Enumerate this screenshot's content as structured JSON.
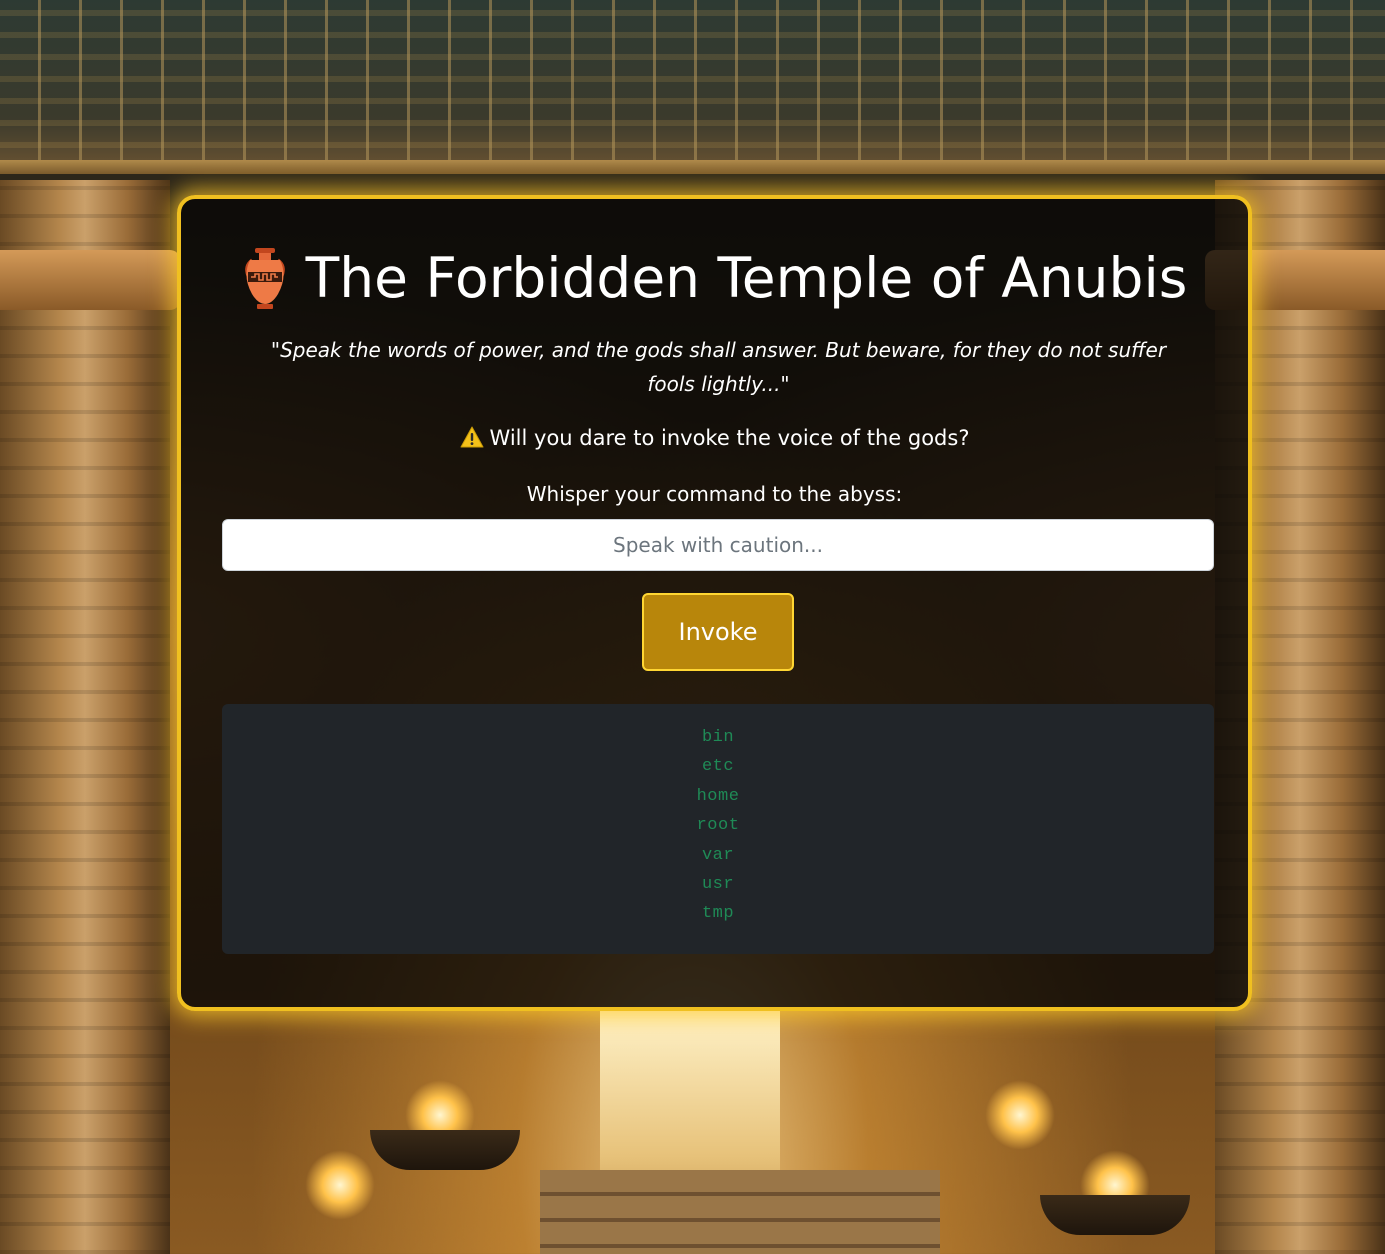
{
  "header": {
    "urn_icon": "amphora-icon",
    "title": "The Forbidden Temple of Anubis",
    "subtitle": "\"Speak the words of power, and the gods shall answer. But beware, for they do not suffer fools lightly...\""
  },
  "warning": {
    "icon": "warning-icon",
    "text": "Will you dare to invoke the voice of the gods?"
  },
  "form": {
    "label": "Whisper your command to the abyss:",
    "input_value": "",
    "input_placeholder": "Speak with caution...",
    "submit_label": "Invoke"
  },
  "output": {
    "lines": [
      "bin",
      "etc",
      "home",
      "root",
      "var",
      "usr",
      "tmp"
    ]
  },
  "colors": {
    "panel_border": "#f0c020",
    "button_bg": "#b8860b",
    "output_bg": "#212529",
    "output_text": "#1f8a56"
  }
}
